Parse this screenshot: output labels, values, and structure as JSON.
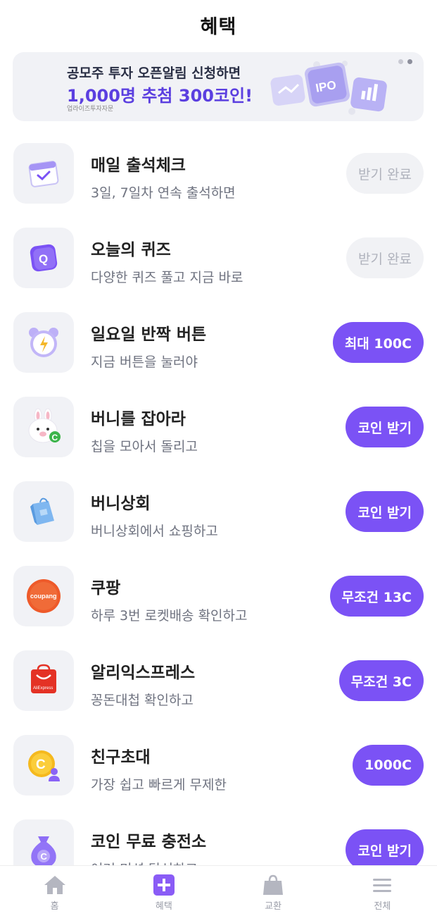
{
  "header": {
    "title": "혜택"
  },
  "banner": {
    "line1": "공모주 투자 오픈알림 신청하면",
    "line2": "1,000명 추첨 300코인!",
    "sub": "업라이즈투자자문",
    "art_text": "IPO"
  },
  "items": [
    {
      "title": "매일 출석체크",
      "subtitle": "3일, 7일차 연속 출석하면",
      "button": "받기 완료",
      "icon": "calendar-icon"
    },
    {
      "title": "오늘의 퀴즈",
      "subtitle": "다양한 퀴즈 풀고 지금 바로",
      "button": "받기 완료",
      "icon": "quiz-icon",
      "icon_text": "Q"
    },
    {
      "title": "일요일 반짝 버튼",
      "subtitle": "지금 버튼을 눌러야",
      "button": "최대 100C",
      "icon": "alarm-clock-icon"
    },
    {
      "title": "버니를 잡아라",
      "subtitle": "칩을 모아서 돌리고",
      "button": "코인 받기",
      "icon": "bunny-icon",
      "icon_text": "C"
    },
    {
      "title": "버니상회",
      "subtitle": "버니상회에서 쇼핑하고",
      "button": "코인 받기",
      "icon": "shopping-bag-icon"
    },
    {
      "title": "쿠팡",
      "subtitle": "하루 3번 로켓배송 확인하고",
      "button": "무조건 13C",
      "icon": "coupang-logo-icon",
      "icon_text": "coupang"
    },
    {
      "title": "알리익스프레스",
      "subtitle": "꽁돈대첩 확인하고",
      "button": "무조건 3C",
      "icon": "aliexpress-logo-icon",
      "icon_text": "AliExpress"
    },
    {
      "title": "친구초대",
      "subtitle": "가장 쉽고 빠르게 무제한",
      "button": "1000C",
      "icon": "invite-friend-icon",
      "icon_text": "C"
    },
    {
      "title": "코인 무료 충전소",
      "subtitle": "여러 미션 달성하고",
      "button": "코인 받기",
      "icon": "coin-bag-icon",
      "icon_text": "C"
    }
  ],
  "tabs": [
    {
      "label": "홈",
      "icon": "home-icon"
    },
    {
      "label": "혜택",
      "icon": "plus-square-icon"
    },
    {
      "label": "교환",
      "icon": "shopping-bag-icon"
    },
    {
      "label": "전체",
      "icon": "menu-icon"
    }
  ],
  "colors": {
    "accent": "#7b52f5",
    "button_done_bg": "#f1f2f5",
    "button_done_text": "#b0b3bd",
    "icon_bg": "#f1f2f6",
    "banner_highlight": "#5b3fe0"
  }
}
